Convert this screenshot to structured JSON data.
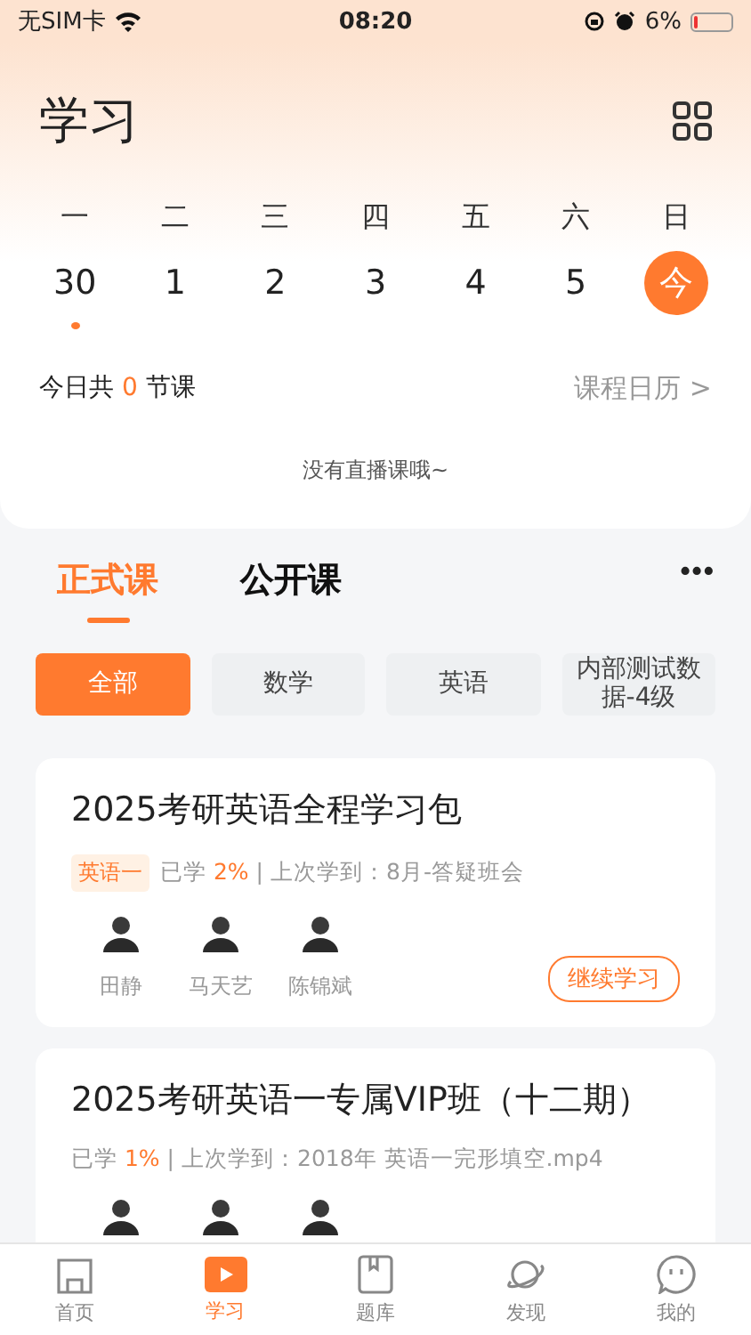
{
  "status_bar": {
    "carrier": "无SIM卡",
    "time": "08:20",
    "battery": "6%"
  },
  "header": {
    "title": "学习"
  },
  "calendar": {
    "weekdays": [
      "一",
      "二",
      "三",
      "四",
      "五",
      "六",
      "日"
    ],
    "days": [
      {
        "label": "30",
        "selected": false,
        "has_class": true
      },
      {
        "label": "1",
        "selected": false,
        "has_class": false
      },
      {
        "label": "2",
        "selected": false,
        "has_class": false
      },
      {
        "label": "3",
        "selected": false,
        "has_class": false
      },
      {
        "label": "4",
        "selected": false,
        "has_class": false
      },
      {
        "label": "5",
        "selected": false,
        "has_class": false
      },
      {
        "label": "今",
        "selected": true,
        "has_class": false
      }
    ],
    "summary_prefix": "今日共",
    "summary_count": "0",
    "summary_suffix": "节课",
    "calendar_link": "课程日历",
    "calendar_link_icon": ">",
    "empty_text": "没有直播课哦~"
  },
  "course_tabs": [
    {
      "label": "正式课",
      "selected": true
    },
    {
      "label": "公开课",
      "selected": false
    }
  ],
  "more_icon": "•••",
  "categories": [
    {
      "label": "全部",
      "selected": true
    },
    {
      "label": "数学",
      "selected": false
    },
    {
      "label": "英语",
      "selected": false
    },
    {
      "label": "内部测试数据-4级",
      "selected": false
    }
  ],
  "courses": [
    {
      "title": "2025考研英语全程学习包",
      "tag": "英语一",
      "progress_prefix": "已学",
      "progress": "2%",
      "last_studied": "| 上次学到：8月-答疑班会",
      "teachers": [
        "田静",
        "马天艺",
        "陈锦斌"
      ],
      "button": "继续学习"
    },
    {
      "title": "2025考研英语一专属VIP班（十二期）",
      "progress_prefix": "已学",
      "progress": "1%",
      "last_studied": "| 上次学到：2018年 英语一完形填空.mp4"
    }
  ],
  "tab_bar": [
    {
      "label": "首页",
      "selected": false
    },
    {
      "label": "学习",
      "selected": true
    },
    {
      "label": "题库",
      "selected": false
    },
    {
      "label": "发现",
      "selected": false
    },
    {
      "label": "我的",
      "selected": false
    }
  ]
}
